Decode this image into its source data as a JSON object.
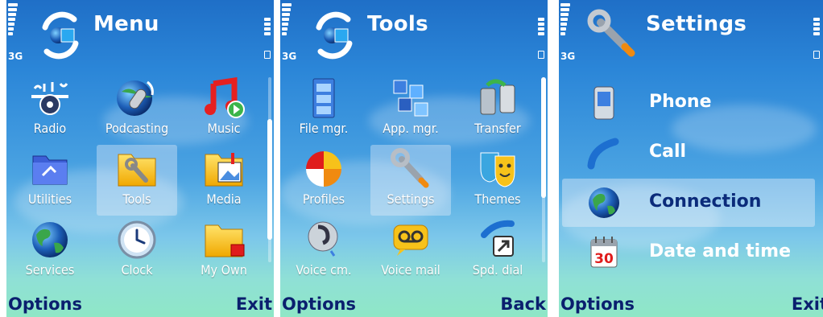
{
  "status": {
    "network": "3G"
  },
  "screens": [
    {
      "title": "Menu",
      "title_icon": "menu-icon",
      "items": [
        {
          "label": "Radio",
          "icon": "radio-icon"
        },
        {
          "label": "Podcasting",
          "icon": "podcasting-icon"
        },
        {
          "label": "Music",
          "icon": "music-icon"
        },
        {
          "label": "Utilities",
          "icon": "utilities-folder-icon"
        },
        {
          "label": "Tools",
          "icon": "tools-folder-icon",
          "selected": true
        },
        {
          "label": "Media",
          "icon": "media-folder-icon"
        },
        {
          "label": "Services",
          "icon": "globe-icon"
        },
        {
          "label": "Clock",
          "icon": "clock-icon"
        },
        {
          "label": "My Own",
          "icon": "my-own-folder-icon"
        }
      ],
      "softkeys": {
        "left": "Options",
        "right": "Exit"
      }
    },
    {
      "title": "Tools",
      "title_icon": "menu-icon",
      "items": [
        {
          "label": "File mgr.",
          "icon": "file-manager-icon"
        },
        {
          "label": "App. mgr.",
          "icon": "app-manager-icon"
        },
        {
          "label": "Transfer",
          "icon": "transfer-icon"
        },
        {
          "label": "Profiles",
          "icon": "profiles-icon"
        },
        {
          "label": "Settings",
          "icon": "settings-wrench-icon",
          "selected": true
        },
        {
          "label": "Themes",
          "icon": "themes-icon"
        },
        {
          "label": "Voice cm.",
          "icon": "voice-command-icon"
        },
        {
          "label": "Voice mail",
          "icon": "voice-mail-icon"
        },
        {
          "label": "Spd. dial",
          "icon": "speed-dial-icon"
        }
      ],
      "softkeys": {
        "left": "Options",
        "right": "Back"
      }
    },
    {
      "title": "Settings",
      "title_icon": "settings-wrench-icon",
      "items": [
        {
          "label": "Phone",
          "icon": "phone-icon"
        },
        {
          "label": "Call",
          "icon": "call-icon"
        },
        {
          "label": "Connection",
          "icon": "globe-icon",
          "selected": true
        },
        {
          "label": "Date and time",
          "icon": "calendar-icon",
          "badge": "30"
        }
      ],
      "softkeys": {
        "left": "Options",
        "right": "Exit"
      }
    }
  ],
  "colors": {
    "softkey": "#0a1f6e",
    "selected_text": "#0b2b7a",
    "text": "#ffffff"
  }
}
